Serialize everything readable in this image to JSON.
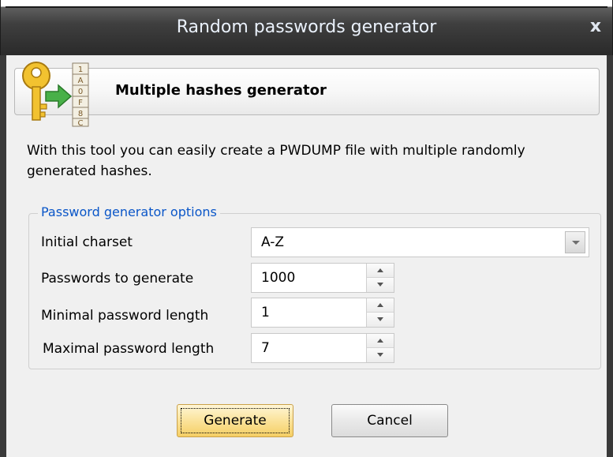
{
  "window": {
    "title": "Random passwords generator",
    "close_label": "x"
  },
  "header": {
    "title": "Multiple hashes generator",
    "icon": "key-with-hash-table-icon"
  },
  "description": "With this tool you can easily create a PWDUMP file with multiple randomly generated hashes.",
  "options": {
    "group_title": "Password generator options",
    "charset": {
      "label": "Initial charset",
      "value": "A-Z"
    },
    "count": {
      "label": "Passwords to generate",
      "value": "1000"
    },
    "min_length": {
      "label": "Minimal password length",
      "value": "1"
    },
    "max_length": {
      "label": "Maximal password length",
      "value": "7"
    }
  },
  "buttons": {
    "generate": "Generate",
    "cancel": "Cancel"
  },
  "colors": {
    "group_title": "#0a56c8",
    "generate_button": "#fbe39a",
    "titlebar": "#3f3f3f"
  }
}
